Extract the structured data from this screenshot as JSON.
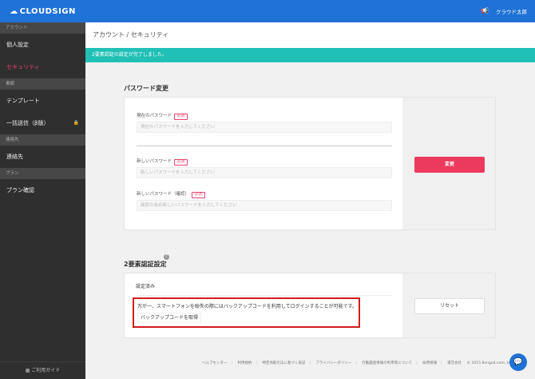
{
  "brand": {
    "name": "CLOUDSIGN"
  },
  "sidebar": {
    "sections": [
      {
        "heading": "アカウント",
        "items": [
          {
            "label": "個人設定"
          },
          {
            "label": "セキュリティ"
          }
        ]
      },
      {
        "heading": "書類",
        "items": [
          {
            "label": "テンプレート"
          },
          {
            "label": "一括送信（β版）"
          }
        ]
      },
      {
        "heading": "連絡先",
        "items": [
          {
            "label": "連絡先"
          }
        ]
      },
      {
        "heading": "プラン",
        "items": [
          {
            "label": "プラン確認"
          }
        ]
      }
    ],
    "guide_label": "ご利用ガイド"
  },
  "header": {
    "user_name": "クラウド太郎"
  },
  "breadcrumb": "アカウント / セキュリティ",
  "banner": "2要素認証の設定が完了しました。",
  "password": {
    "title": "パスワード変更",
    "required_badge": "必須",
    "current_label": "現在のパスワード",
    "current_placeholder": "現在のパスワードを入力してください",
    "new_label": "新しいパスワード",
    "new_placeholder": "新しいパスワードを入力してください",
    "confirm_label": "新しいパスワード（確認）",
    "confirm_placeholder": "確認の為め新しいパスワードを入力してください",
    "change_button": "変更"
  },
  "two_factor": {
    "title": "2要素認証設定",
    "status": "設定済み",
    "notice": "万が一、スマートフォンを紛失の際にはバックアップコードを利用してログインすることが可能です。",
    "backup_button": "バックアップコードを取得",
    "reset_button": "リセット"
  },
  "footer": {
    "links": [
      "ヘルプセンター",
      "利用規約",
      "特定商取引法に基づく表記",
      "プライバシーポリシー",
      "行動履歴情報の利用等について",
      "採用情報",
      "運営会社"
    ],
    "copyright": "© 2015 Bengo4.com, Inc."
  },
  "colors": {
    "primary": "#1f73d8",
    "accent": "#ec3a5f",
    "banner": "#20c0b6",
    "highlight": "#d31c1c"
  },
  "icons": {
    "megaphone": "megaphone-icon",
    "lock": "lock-icon",
    "help": "help-icon",
    "chat": "chat-icon",
    "guide": "grid-icon"
  }
}
